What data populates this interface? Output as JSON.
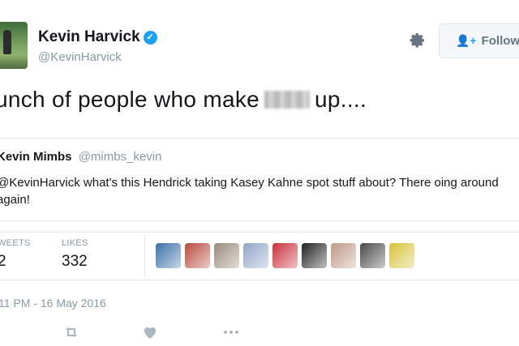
{
  "author": {
    "name": "Kevin Harvick",
    "handle": "@KevinHarvick",
    "verified_icon": "verified-badge-icon"
  },
  "actions": {
    "follow_label": "Follow",
    "follow_icon": "person-plus-icon",
    "settings_icon": "gear-icon"
  },
  "tweet": {
    "text_before": "unch of people who make",
    "text_after": "up...."
  },
  "quoted_tweet": {
    "name": "Kevin Mimbs",
    "handle": "@mimbs_kevin",
    "text": "@KevinHarvick what's this Hendrick taking Kasey Kahne spot stuff about? There oing around again!"
  },
  "stats": {
    "retweets_label": "WEETS",
    "retweets_value": "2",
    "likes_label": "LIKES",
    "likes_value": "332"
  },
  "likers": [
    "#3b6fa8",
    "#b84a3c",
    "#9a8a7a",
    "#8fa5c8",
    "#c9303a",
    "#222222",
    "#c09a88",
    "#4a4a4a",
    "#d8c23a"
  ],
  "timestamp": "11 PM - 16 May 2016",
  "footer_actions": [
    "retweet-icon",
    "heart-icon",
    "more-icon"
  ],
  "colors": {
    "accent": "#1da1f2",
    "muted": "#8899a6",
    "text": "#14171a",
    "border": "#e1e8ed"
  }
}
